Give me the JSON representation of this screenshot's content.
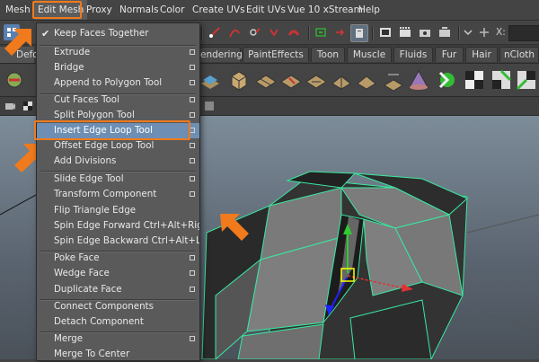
{
  "menubar": {
    "items": [
      "Mesh",
      "Edit Mesh",
      "Proxy",
      "Normals",
      "Color",
      "Create UVs",
      "Edit UVs",
      "Vue 10 xStream",
      "Help"
    ]
  },
  "statusline": {
    "x_label": "X:"
  },
  "shelf_tabs": [
    "Defo",
    "endering",
    "PaintEffects",
    "Toon",
    "Muscle",
    "Fluids",
    "Fur",
    "Hair",
    "nCloth"
  ],
  "menu": {
    "items": [
      {
        "label": "Keep Faces Together",
        "checked": true,
        "option": false
      },
      {
        "label": "Extrude",
        "option": true
      },
      {
        "label": "Bridge",
        "option": true
      },
      {
        "label": "Append to Polygon Tool",
        "option": true
      },
      {
        "label": "Cut Faces Tool",
        "option": true
      },
      {
        "label": "Split Polygon Tool",
        "option": true
      },
      {
        "label": "Insert Edge Loop Tool",
        "option": true,
        "highlighted": true
      },
      {
        "label": "Offset Edge Loop Tool",
        "option": true
      },
      {
        "label": "Add Divisions",
        "option": true
      },
      {
        "label": "Slide Edge Tool",
        "option": true
      },
      {
        "label": "Transform Component",
        "option": true
      },
      {
        "label": "Flip Triangle Edge",
        "option": false
      },
      {
        "label": "Spin Edge Forward",
        "shortcut": "Ctrl+Alt+Right",
        "option": false
      },
      {
        "label": "Spin Edge Backward",
        "shortcut": "Ctrl+Alt+Left",
        "option": false
      },
      {
        "label": "Poke Face",
        "option": true
      },
      {
        "label": "Wedge Face",
        "option": true
      },
      {
        "label": "Duplicate Face",
        "option": true
      },
      {
        "label": "Connect Components",
        "option": false
      },
      {
        "label": "Detach Component",
        "option": false
      },
      {
        "label": "Merge",
        "option": true
      },
      {
        "label": "Merge To Center",
        "option": false
      }
    ]
  },
  "colors": {
    "accent_orange": "#f07a1c",
    "menu_highlight": "#6e8fb3",
    "wireframe": "#39e8a0"
  }
}
